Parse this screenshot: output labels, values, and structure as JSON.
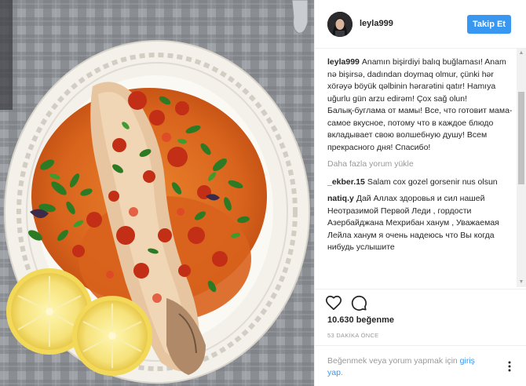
{
  "header": {
    "username": "leyla999",
    "follow_label": "Takip Et"
  },
  "caption": {
    "username": "leyla999",
    "text_az": "Anamın bişirdiyi balıq buğlaması! Anam nə bişirsə, dadından doymaq olmur, çünki hər xörəyə böyük qəlbinin hərarətini qatır! Hamıya uğurlu gün arzu edirəm! Çox sağ olun!",
    "text_ru": "Балық-буглама от мамы! Все, что готовит мама- самое вкусное, потому что в каждое блюдо вкладывает свою волшебную душу! Всем прекрасного дня! Спасибо!"
  },
  "load_more_label": "Daha fazla yorum yükle",
  "comments": [
    {
      "username": "_ekber.15",
      "text": "Salam cox gozel gorsenir nus olsun"
    },
    {
      "username": "natiq.y",
      "text": "Дай Аллах здоровья и сил нашей Неотразимой Первой Леди , гордости Азербайджана Мехрибан ханум , Уважаемая Лейла ханум я очень надеюсь что Вы когда нибудь услышите"
    }
  ],
  "likes": "10.630 beğenme",
  "timestamp": "53 DAKİKA ÖNCE",
  "login_prompt": {
    "text": "Beğenmek veya yorum yapmak için",
    "link_1": "giriş",
    "link_2": "yap",
    "suffix": "."
  },
  "icons": {
    "like": "heart-icon",
    "comment": "comment-bubble-icon",
    "options": "more-options-icon"
  },
  "colors": {
    "accent": "#3897f0",
    "text": "#262626",
    "muted": "#999999"
  }
}
